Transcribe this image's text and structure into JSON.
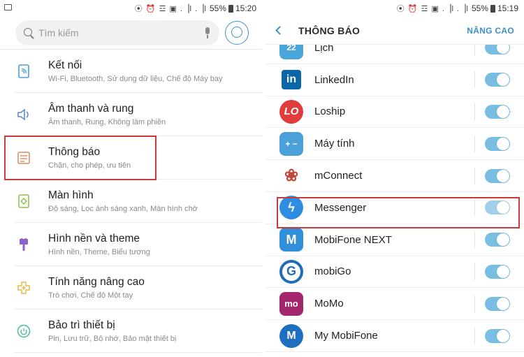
{
  "left": {
    "status": {
      "icons": "⦿ ⏰ ☲ ▣ .▕l .▕l",
      "battery": "55%",
      "time": "15:20"
    },
    "search": {
      "placeholder": "Tìm kiếm"
    },
    "items": [
      {
        "title": "Kết nối",
        "subtitle": "Wi-Fi, Bluetooth, Sử dụng dữ liệu, Chế độ Máy bay",
        "icon": "connection-icon"
      },
      {
        "title": "Âm thanh và rung",
        "subtitle": "Âm thanh, Rung, Không làm phiền",
        "icon": "speaker-icon"
      },
      {
        "title": "Thông báo",
        "subtitle": "Chặn, cho phép, ưu tiên",
        "icon": "notification-icon"
      },
      {
        "title": "Màn hình",
        "subtitle": "Độ sáng, Lọc ánh sáng xanh, Màn hình chờ",
        "icon": "display-icon"
      },
      {
        "title": "Hình nền và theme",
        "subtitle": "Hình nền, Theme, Biểu tượng",
        "icon": "brush-icon"
      },
      {
        "title": "Tính năng nâng cao",
        "subtitle": "Trò chơi, Chế độ Một tay",
        "icon": "advanced-features-icon"
      },
      {
        "title": "Bảo trì thiết bị",
        "subtitle": "Pin, Lưu trữ, Bộ nhớ, Bảo mật thiết bị",
        "icon": "device-maintenance-icon"
      }
    ]
  },
  "right": {
    "status": {
      "icons": "⦿ ⏰ ☲ ▣ .▕l .▕l",
      "battery": "55%",
      "time": "15:19"
    },
    "title": "THÔNG BÁO",
    "action": "NÂNG CAO",
    "apps": [
      {
        "name": "Lịch",
        "icon_text": "22",
        "color": "#4aa5d9",
        "on": true
      },
      {
        "name": "LinkedIn",
        "icon_text": "in",
        "color": "#0a66a8",
        "on": true
      },
      {
        "name": "Loship",
        "icon_text": "LO",
        "color": "#e13c3c",
        "on": true
      },
      {
        "name": "Máy tính",
        "icon_text": "+ −",
        "color": "#4aa0d8",
        "on": true
      },
      {
        "name": "mConnect",
        "icon_text": "❀",
        "color": "#ffffff",
        "on": true
      },
      {
        "name": "Messenger",
        "icon_text": "ϟ",
        "color": "#2e8de0",
        "on": true
      },
      {
        "name": "MobiFone NEXT",
        "icon_text": "M",
        "color": "#2f8fd8",
        "on": true
      },
      {
        "name": "mobiGo",
        "icon_text": "G",
        "color": "#ffffff",
        "on": true
      },
      {
        "name": "MoMo",
        "icon_text": "mo",
        "color": "#a4266c",
        "on": true
      },
      {
        "name": "My MobiFone",
        "icon_text": "M",
        "color": "#1e6fc0",
        "on": true
      }
    ]
  }
}
